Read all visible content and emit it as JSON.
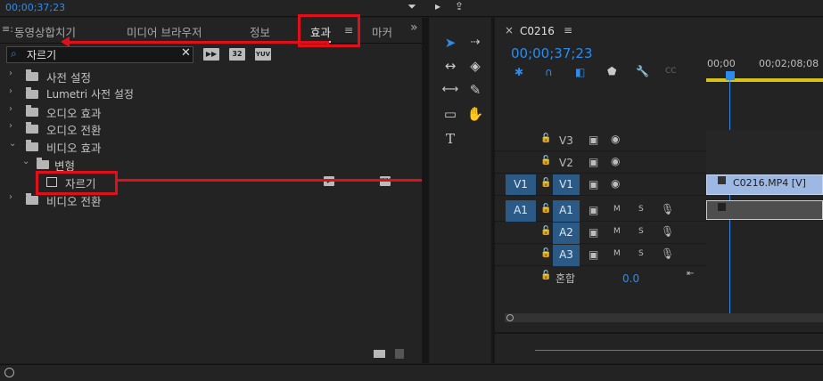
{
  "top": {
    "timecode": "00;00;37;23"
  },
  "effects_panel": {
    "tabs": [
      "동영상합치기",
      "미디어 브라우저",
      "정보",
      "효과",
      "마커"
    ],
    "active_tab": "효과",
    "menu_icon": "≡",
    "overflow_icon": "»",
    "search": {
      "value": "자르기"
    },
    "filter_badges": [
      "32",
      "YUV"
    ],
    "tree": [
      {
        "label": "사전 설정",
        "level": 0,
        "expanded": false
      },
      {
        "label": "Lumetri 사전 설정",
        "level": 0,
        "expanded": false
      },
      {
        "label": "오디오 효과",
        "level": 0,
        "expanded": false
      },
      {
        "label": "오디오 전환",
        "level": 0,
        "expanded": false
      },
      {
        "label": "비디오 효과",
        "level": 0,
        "expanded": true
      },
      {
        "label": "변형",
        "level": 1,
        "expanded": true
      },
      {
        "label": "자르기",
        "level": 2,
        "effect": true
      },
      {
        "label": "비디오 전환",
        "level": 0,
        "expanded": false
      }
    ]
  },
  "timeline": {
    "sequence_name": "C0216",
    "timecode": "00;00;37;23",
    "ruler": [
      "00;00",
      "00;02;08;08"
    ],
    "tracks": [
      {
        "name": "V3"
      },
      {
        "name": "V2"
      },
      {
        "name": "V1",
        "source": "V1"
      },
      {
        "name": "A1",
        "source": "A1",
        "audio": true
      },
      {
        "name": "A2",
        "audio": true
      },
      {
        "name": "A3",
        "audio": true
      }
    ],
    "mix": {
      "label": "혼합",
      "value": "0.0"
    },
    "clip": {
      "label": "C0216.MP4 [V]"
    },
    "audio_buttons": [
      "M",
      "S"
    ]
  },
  "colors": {
    "accent": "#2d8ceb",
    "annotation": "#e0101a"
  }
}
